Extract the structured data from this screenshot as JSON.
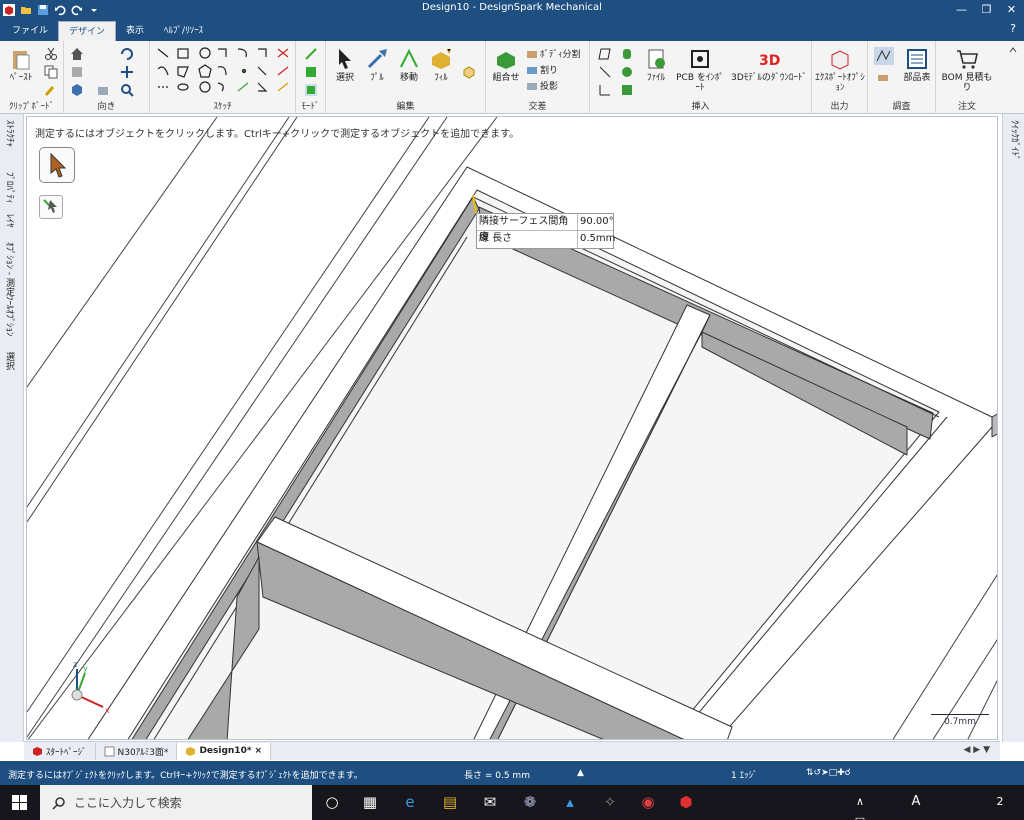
{
  "window": {
    "title": "Design10 - DesignSpark Mechanical"
  },
  "menu_tabs": [
    "ファイル",
    "デザイン",
    "表示",
    "ﾍﾙﾌﾟ/ﾘｿｰｽ"
  ],
  "ribbon": {
    "clipboard": {
      "paste": "ﾍﾟｰｽﾄ",
      "label": "ｸﾘｯﾌﾟﾎﾞｰﾄﾞ"
    },
    "orient": {
      "label": "向き"
    },
    "sketch": {
      "label": "ｽｹｯﾁ"
    },
    "mode": {
      "label": "ﾓｰﾄﾞ"
    },
    "edit": {
      "select": "選択",
      "pull": "ﾌﾟﾙ",
      "move": "移動",
      "fill": "ﾌｨﾙ",
      "label": "編集"
    },
    "intersect": {
      "combine": "組合せ",
      "split_body": "ﾎﾞﾃﾞｨ分割",
      "split": "割り",
      "project": "投影",
      "label": "交差"
    },
    "insert": {
      "file": "ﾌｧｲﾙ",
      "pcb": "PCB をｲﾝﾎﾟｰﾄ",
      "model3d": "3Dﾓﾃﾞﾙのﾀﾞｳﾝﾛｰﾄﾞ",
      "label": "挿入"
    },
    "output": {
      "export": "ｴｸｽﾎﾟｰﾄｵﾌﾟｼｮﾝ",
      "label": "出力"
    },
    "inspect": {
      "parts": "部品表",
      "label": "調査"
    },
    "order": {
      "bom": "BOM 見積もり",
      "label": "注文"
    }
  },
  "left_tabs": [
    "ｽﾄﾗｸﾁｬ",
    "ﾌﾟﾛﾊﾟﾃｨ",
    "ﾚｲﾔ",
    "ｵﾌﾟｼｮﾝ - 測定ﾂｰﾙｵﾌﾟｼｮﾝ",
    "選択"
  ],
  "right_tabs": [
    "ｸｲｯｸｶﾞｲﾄﾞ"
  ],
  "viewport": {
    "hint": "測定するにはオブジェクトをクリックします。Ctrlキー+クリックで測定するオブジェクトを追加できます。",
    "scale": "0.7mm"
  },
  "measure": [
    {
      "label": "隣接サーフェス間角度",
      "value": "90.00°"
    },
    {
      "label": "線 長さ",
      "value": "0.5mm"
    }
  ],
  "doc_tabs": [
    {
      "label": "ｽﾀｰﾄﾍﾟｰｼﾞ"
    },
    {
      "label": "N30ｱﾙﾐ3面*"
    },
    {
      "label": "Design10*"
    }
  ],
  "status": {
    "hint": "測定するにはｵﾌﾞｼﾞｪｸﾄをｸﾘｯｸします。Ctrlｷｰ+ｸﾘｯｸで測定するｵﾌﾞｼﾞｪｸﾄを追加できます。",
    "length": "長さ = 0.5 mm",
    "edges": "1 ｴｯｼﾞ"
  },
  "taskbar": {
    "search": "ここに入力して検索",
    "ime": "A",
    "notif": "2"
  },
  "colors": {
    "titlebar": "#1e4f80",
    "ribbon": "#f4f4f4",
    "face_dark": "#a9a9a9"
  }
}
